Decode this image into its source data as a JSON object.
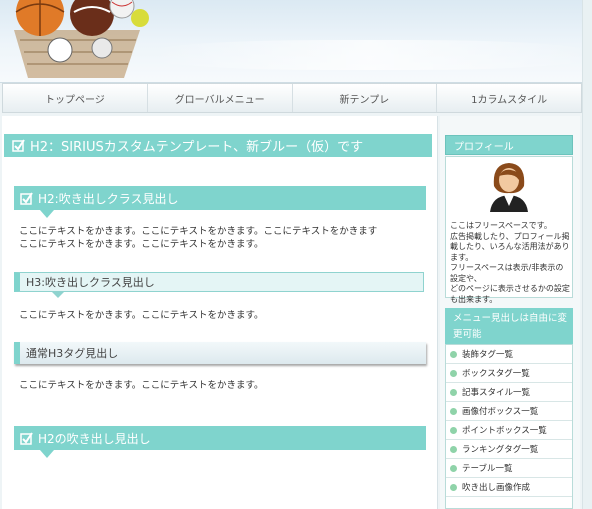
{
  "nav": {
    "items": [
      "トップページ",
      "グローバルメニュー",
      "新テンプレ",
      "1カラムスタイル"
    ]
  },
  "main": {
    "title": "H2：SIRIUSカスタムテンプレート、新ブルー（仮）です",
    "section1": {
      "heading": "H2:吹き出しクラス見出し",
      "lines": [
        "ここにテキストをかきます。ここにテキストをかきます。ここにテキストをかきます",
        "ここにテキストをかきます。ここにテキストをかきます。"
      ]
    },
    "section2": {
      "heading": "H3:吹き出しクラス見出し",
      "text": "ここにテキストをかきます。ここにテキストをかきます。"
    },
    "section3": {
      "heading": "通常H3タグ見出し",
      "text": "ここにテキストをかきます。ここにテキストをかきます。"
    },
    "section4": {
      "heading": "H2の吹き出し見出し"
    }
  },
  "sidebar": {
    "profile_title": "プロフィール",
    "profile_lines": [
      "ここはフリースペースです。",
      "広告掲載したり、プロフィール掲",
      "載したり、いろんな活用法があり",
      "ます。",
      "フリースペースは表示/非表示の",
      "設定や、",
      "どのページに表示させるかの設定",
      "も出来ます。"
    ],
    "menu_title": "メニュー見出しは自由に変更可能",
    "menu_items": [
      "装飾タグ一覧",
      "ボックスタグ一覧",
      "記事スタイル一覧",
      "画像付ボックス一覧",
      "ポイントボックス一覧",
      "ランキングタグ一覧",
      "テーブル一覧",
      "吹き出し画像作成"
    ]
  },
  "colors": {
    "accent": "#7fd4cd",
    "accent_border": "#8fd3cf",
    "bullet": "#8fd3a9"
  },
  "icons": [
    "sports-balls-logo",
    "checkbox-icon",
    "user-avatar-icon",
    "bullet-icon"
  ]
}
